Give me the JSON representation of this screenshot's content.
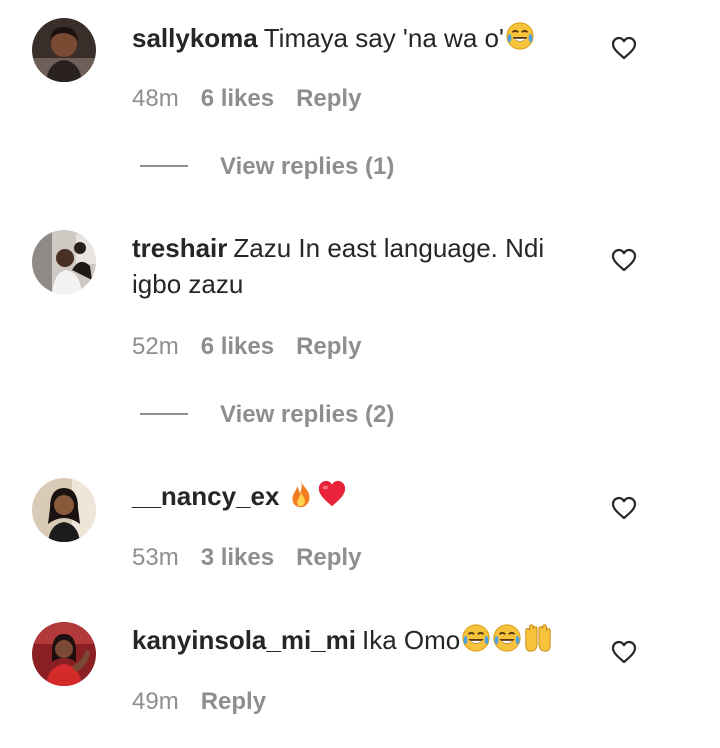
{
  "comments": [
    {
      "username": "sallykoma",
      "text": "Timaya say 'na wa o'",
      "emojis": [
        "laughing-tears"
      ],
      "time": "48m",
      "likes": "6 likes",
      "reply_label": "Reply",
      "view_replies": "View replies (1)"
    },
    {
      "username": "treshair",
      "text": "Zazu In east language. Ndi igbo zazu",
      "emojis": [],
      "time": "52m",
      "likes": "6 likes",
      "reply_label": "Reply",
      "view_replies": "View replies (2)"
    },
    {
      "username": "__nancy_ex",
      "text": "",
      "emojis": [
        "fire",
        "red-heart"
      ],
      "time": "53m",
      "likes": "3 likes",
      "reply_label": "Reply"
    },
    {
      "username": "kanyinsola_mi_mi",
      "text": "Ika Omo",
      "emojis": [
        "laughing-tears",
        "laughing-tears",
        "raised-hands"
      ],
      "time": "49m",
      "reply_label": "Reply"
    }
  ],
  "colors": {
    "text": "#262626",
    "secondary": "#8e8e8e",
    "background": "#ffffff"
  },
  "icons": {
    "like": "heart-outline-icon"
  }
}
